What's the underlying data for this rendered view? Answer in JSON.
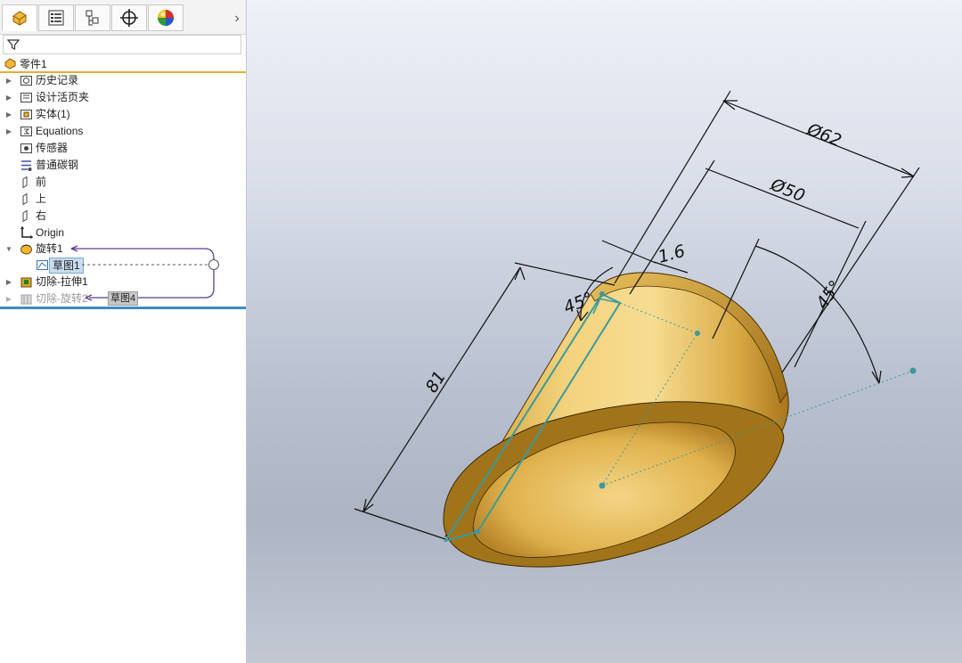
{
  "tabs": [
    {
      "name": "feature-manager-tab",
      "icon": "part-features-icon"
    },
    {
      "name": "property-manager-tab",
      "icon": "property-list-icon"
    },
    {
      "name": "configuration-manager-tab",
      "icon": "configuration-icon"
    },
    {
      "name": "dimxpert-tab",
      "icon": "crosshair-icon"
    },
    {
      "name": "display-manager-tab",
      "icon": "appearance-sphere-icon"
    }
  ],
  "tab_overflow": "›",
  "tree": {
    "root": "零件1",
    "items": [
      {
        "label": "历史记录",
        "icon": "history-folder-icon"
      },
      {
        "label": "设计活页夹",
        "icon": "binder-icon"
      },
      {
        "label": "实体(1)",
        "icon": "solid-bodies-icon"
      },
      {
        "label": "Equations",
        "icon": "equations-icon"
      },
      {
        "label": "传感器",
        "icon": "sensor-icon"
      },
      {
        "label": "普通碳钢",
        "icon": "material-icon"
      },
      {
        "label": "前",
        "icon": "plane-icon"
      },
      {
        "label": "上",
        "icon": "plane-icon"
      },
      {
        "label": "右",
        "icon": "plane-icon"
      },
      {
        "label": "Origin",
        "icon": "origin-icon"
      },
      {
        "label": "旋转1",
        "icon": "revolve-icon"
      },
      {
        "label": "草图1",
        "icon": "sketch-icon"
      },
      {
        "label": "切除-拉伸1",
        "icon": "cut-extrude-icon"
      },
      {
        "label": "切除-旋转2",
        "icon": "cut-revolve-icon"
      }
    ],
    "sketch_tag": "草图4"
  },
  "dimensions": {
    "d62": "Ø62",
    "d50": "Ø50",
    "t": "1.6",
    "angle_left": "45°",
    "angle_right": "45°",
    "length": "81"
  },
  "colors": {
    "accent_orange": "#e2ad36",
    "rollback_blue": "#3a8cc7",
    "part_gold": "#e7c061",
    "sketch_teal": "#3a9aa0"
  }
}
